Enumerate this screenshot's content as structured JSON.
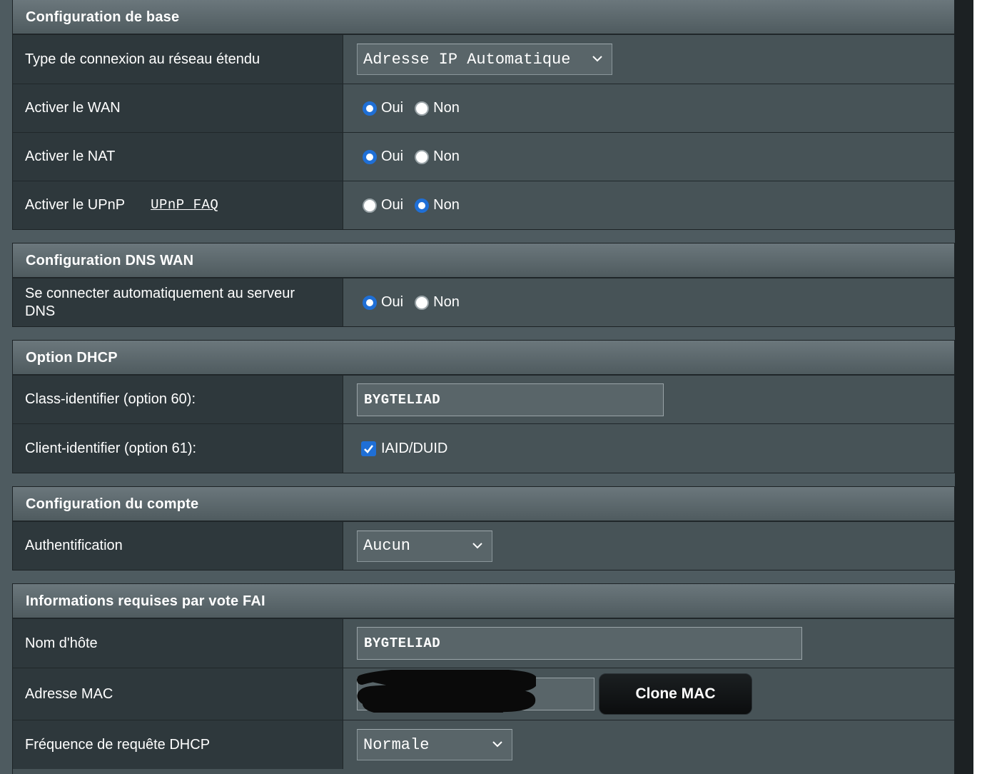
{
  "sections": {
    "base": {
      "title": "Configuration de base",
      "wan_type_label": "Type de connexion au réseau étendu",
      "wan_type_value": "Adresse IP Automatique",
      "enable_wan_label": "Activer le WAN",
      "enable_nat_label": "Activer le NAT",
      "enable_upnp_label": "Activer le UPnP",
      "upnp_faq_link": "UPnP FAQ"
    },
    "dns": {
      "title": "Configuration DNS WAN",
      "auto_dns_label": "Se connecter automatiquement au serveur DNS"
    },
    "dhcp": {
      "title": "Option DHCP",
      "class_id_label": "Class-identifier (option 60):",
      "class_id_value": "BYGTELIAD",
      "client_id_label": "Client-identifier (option 61):",
      "client_id_checkbox_label": "IAID/DUID"
    },
    "account": {
      "title": "Configuration du compte",
      "auth_label": "Authentification",
      "auth_value": "Aucun"
    },
    "isp": {
      "title": "Informations requises par vote FAI",
      "hostname_label": "Nom d'hôte",
      "hostname_value": "BYGTELIAD",
      "mac_label": "Adresse MAC",
      "clone_mac_label": "Clone MAC",
      "dhcp_freq_label": "Fréquence de requête DHCP",
      "dhcp_freq_value": "Normale"
    }
  },
  "radio": {
    "yes": "Oui",
    "no": "Non"
  },
  "state": {
    "enable_wan": "Oui",
    "enable_nat": "Oui",
    "enable_upnp": "Non",
    "auto_dns": "Oui",
    "client_id_checked": true
  },
  "colors": {
    "accent": "#1f6fd6",
    "header_gradient_top": "#6b777c",
    "label_bg": "#2e383c",
    "field_bg": "#475357"
  }
}
